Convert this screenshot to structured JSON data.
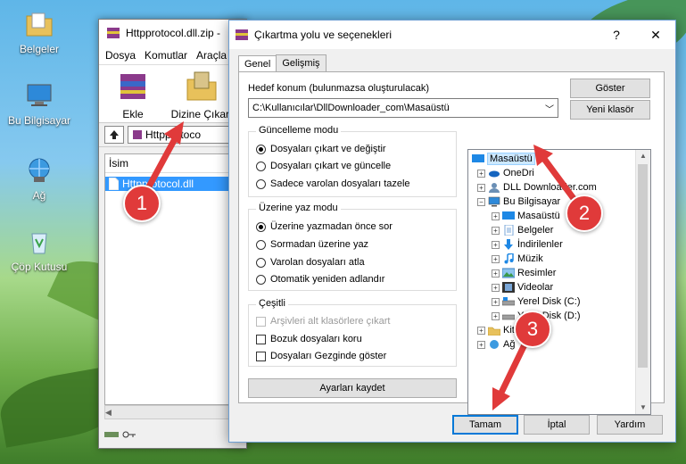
{
  "desktop": {
    "icons": [
      {
        "label": "Belgeler",
        "icon": "folder-documents-icon"
      },
      {
        "label": "Bu Bilgisayar",
        "icon": "computer-icon"
      },
      {
        "label": "Ağ",
        "icon": "network-icon"
      },
      {
        "label": "Çöp Kutusu",
        "icon": "recycle-bin-icon"
      }
    ]
  },
  "winrar": {
    "title": "Httpprotocol.dll.zip -",
    "menu": [
      "Dosya",
      "Komutlar",
      "Araçla"
    ],
    "tools": {
      "add": "Ekle",
      "extract": "Dizine Çıkart"
    },
    "address": "Httpprotoco",
    "column_name": "İsim",
    "file": "Httpprotocol.dll"
  },
  "dialog": {
    "title": "Çıkartma yolu ve seçenekleri",
    "help": "?",
    "close": "✕",
    "tabs": [
      "Genel",
      "Gelişmiş"
    ],
    "dest_label": "Hedef konum (bulunmazsa oluşturulacak)",
    "dest_value": "C:\\Kullanıcılar\\DllDownloader_com\\Masaüstü",
    "show_button": "Göster",
    "new_folder_button": "Yeni klasör",
    "update_mode": {
      "title": "Güncelleme modu",
      "options": [
        "Dosyaları çıkart ve değiştir",
        "Dosyaları çıkart ve güncelle",
        "Sadece varolan dosyaları tazele"
      ],
      "selected": 0
    },
    "overwrite_mode": {
      "title": "Üzerine yaz modu",
      "options": [
        "Üzerine yazmadan önce sor",
        "Sormadan üzerine yaz",
        "Varolan dosyaları atla",
        "Otomatik yeniden adlandır"
      ],
      "selected": 0
    },
    "misc": {
      "title": "Çeşitli",
      "options": [
        "Arşivleri alt klasörlere çıkart",
        "Bozuk dosyaları koru",
        "Dosyaları Gezginde göster"
      ],
      "disabled": [
        true,
        false,
        false
      ]
    },
    "save_settings": "Ayarları kaydet",
    "tree": [
      {
        "label": "Masaüstü",
        "icon": "desktop-icon",
        "selected": true
      },
      {
        "label": "OneDri",
        "icon": "onedrive-icon",
        "expander": "+"
      },
      {
        "label": "DLL Downloader.com",
        "icon": "user-folder-icon",
        "expander": "+"
      },
      {
        "label": "Bu Bilgisayar",
        "icon": "computer-icon",
        "expander": "−"
      },
      {
        "label": "Masaüstü",
        "icon": "desktop-icon",
        "expander": "+"
      },
      {
        "label": "Belgeler",
        "icon": "documents-icon",
        "expander": "+"
      },
      {
        "label": "İndirilenler",
        "icon": "downloads-icon",
        "expander": "+"
      },
      {
        "label": "Müzik",
        "icon": "music-icon",
        "expander": "+"
      },
      {
        "label": "Resimler",
        "icon": "pictures-icon",
        "expander": "+"
      },
      {
        "label": "Videolar",
        "icon": "videos-icon",
        "expander": "+"
      },
      {
        "label": "Yerel Disk (C:)",
        "icon": "disk-icon",
        "expander": "+"
      },
      {
        "label": "Yerel Disk (D:)",
        "icon": "disk-icon",
        "expander": "+"
      },
      {
        "label": "Kitaplıklar",
        "icon": "libraries-icon",
        "expander": "+"
      },
      {
        "label": "Ağ",
        "icon": "network-icon",
        "expander": "+"
      }
    ],
    "ok": "Tamam",
    "cancel": "İptal",
    "help_button": "Yardım"
  },
  "annotations": {
    "step1": "1",
    "step2": "2",
    "step3": "3",
    "color": "#e03a3a"
  }
}
